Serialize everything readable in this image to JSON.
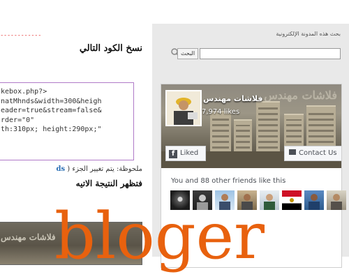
{
  "article": {
    "dashes": "-------------------",
    "copy_heading": "نسخ الكود التالي",
    "code_lines": [
      "kebox.php?>",
      "natMhnds&width=300&heigh",
      "eader=true&stream=false&",
      "rder=\"0\"",
      "th:310px; height:290px;\""
    ],
    "note_prefix": "ملحوظة: يتم تغيير الجزء (",
    "note_highlight": "ds",
    "result_heading": "فتظهر النتيجة الاتيه",
    "preview_title": "فلاشات مهندس"
  },
  "sidebar": {
    "title": "بحث هذه المدونة الإلكترونية",
    "search_button": "البحث",
    "search_value": ""
  },
  "fb_widget": {
    "page_name": "فلاشات مهندس",
    "cover_text": "فلاشات مهندس",
    "likes": "7,974 likes",
    "liked_button": "Liked",
    "contact_button": "Contact Us",
    "friends_text": "You and 88 other friends like this",
    "friend_count_shown": 8
  },
  "watermark": {
    "text": "bloger",
    "color": "#e8610e"
  }
}
